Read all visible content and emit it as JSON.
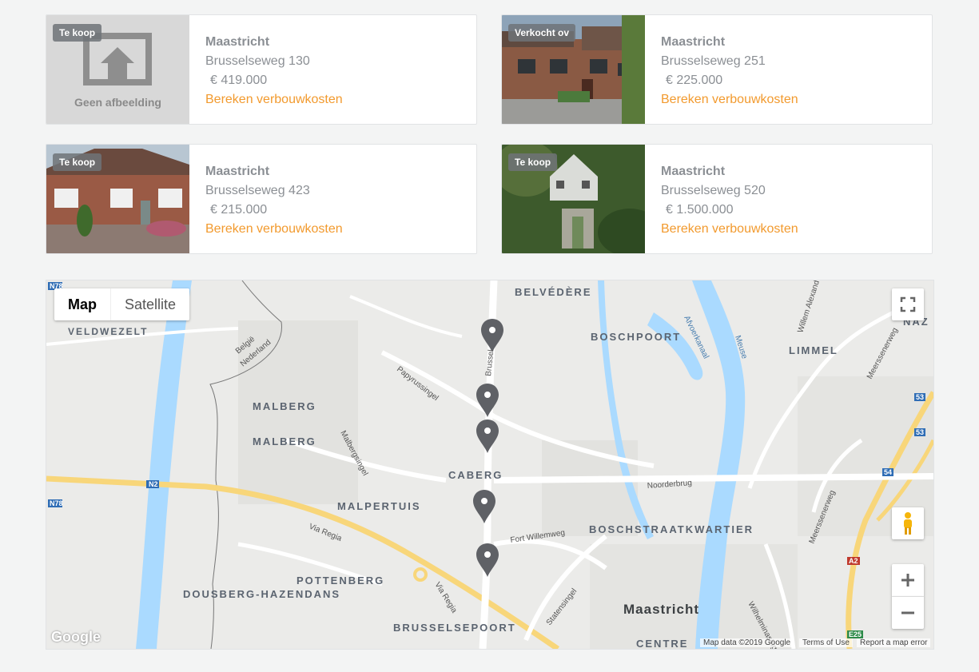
{
  "listings": [
    {
      "badge": "Te koop",
      "city": "Maastricht",
      "street": "Brusselseweg 130",
      "price": "€ 419.000",
      "cta": "Bereken verbouwkosten",
      "image": "Geen afbeelding"
    },
    {
      "badge": "Verkocht ov",
      "city": "Maastricht",
      "street": "Brusselseweg 251",
      "price": "€ 225.000",
      "cta": "Bereken verbouwkosten"
    },
    {
      "badge": "Te koop",
      "city": "Maastricht",
      "street": "Brusselseweg 423",
      "price": "€ 215.000",
      "cta": "Bereken verbouwkosten"
    },
    {
      "badge": "Te koop",
      "city": "Maastricht",
      "street": "Brusselseweg 520",
      "price": "€ 1.500.000",
      "cta": "Bereken verbouwkosten"
    }
  ],
  "map": {
    "type_map": "Map",
    "type_satellite": "Satellite",
    "labels": {
      "veldwezelt": "VELDWEZELT",
      "belvedere": "BELVÉDÈRE",
      "boschpoort": "BOSCHPOORT",
      "limmel": "LIMMEL",
      "malberg1": "MALBERG",
      "malberg2": "MALBERG",
      "caberg": "CABERG",
      "malpertuis": "MALPERTUIS",
      "boschstraat": "BOSCHSTRAATKWARTIER",
      "pottenberg": "POTTENBERG",
      "dousberg": "DOUSBERG-HAZENDANS",
      "brusselsepoort": "BRUSSELSEPOORT",
      "maastricht": "Maastricht",
      "centre": "CENTRE",
      "naz": "NAZ",
      "viaregia1": "Via Regia",
      "viaregia2": "Via Regia",
      "fortwillemweg": "Fort Willemweg",
      "noorderbrug": "Noorderbrug",
      "statensingel": "Statensingel",
      "papyrussingel": "Papyrussingel",
      "malbergsingel": "Malbergsingel",
      "meuse": "Meuse",
      "afvoerkanaal": "Afvoerkanaal",
      "meerssenerweg1": "Meerssenerweg",
      "meerssenerweg2": "Meerssenerweg",
      "willemalex": "Willem Alexander",
      "wilhelminasingel": "Wilhelminasingel",
      "belgie": "België",
      "nederland": "Nederland",
      "brussel": "Brussel"
    },
    "shields": {
      "n78a": "N78",
      "n78b": "N78",
      "n2": "N2",
      "r53a": "53",
      "r53b": "53",
      "r54": "54",
      "a2": "A2",
      "e25": "E25"
    },
    "attribution": {
      "google": "Google",
      "data": "Map data ©2019 Google",
      "terms": "Terms of Use",
      "report": "Report a map error"
    },
    "colors": {
      "water": "#aadaff",
      "motorway": "#f8d67a",
      "land": "#ebebe9",
      "pin": "#5f6166"
    }
  }
}
